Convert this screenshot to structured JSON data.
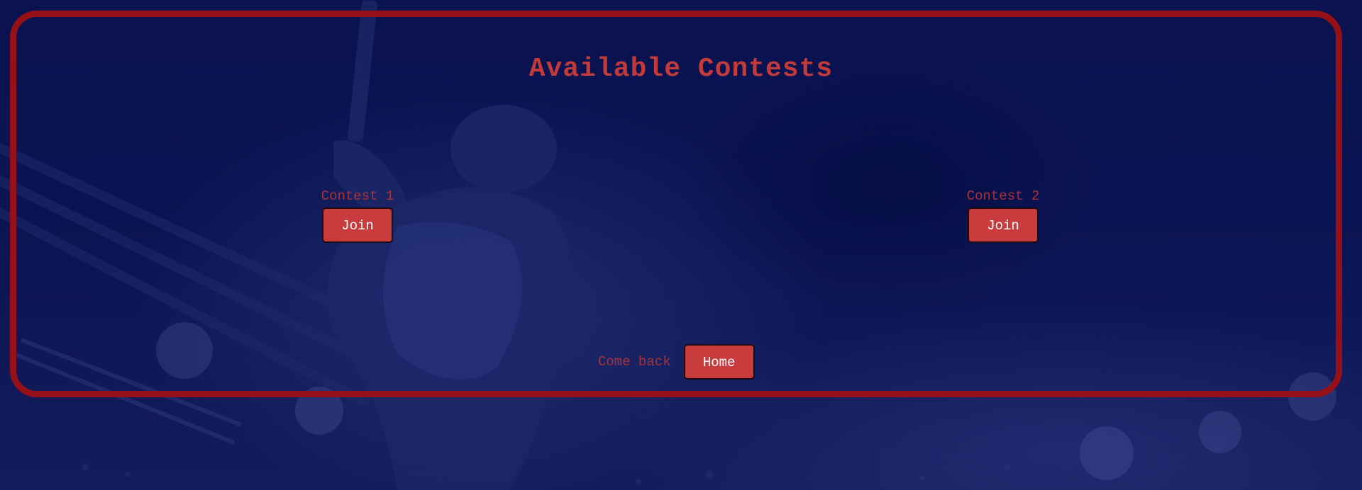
{
  "page": {
    "title": "Available Contests"
  },
  "contests": [
    {
      "label": "Contest 1",
      "button_label": "Join"
    },
    {
      "label": "Contest 2",
      "button_label": "Join"
    }
  ],
  "footer": {
    "text": "Come back",
    "home_label": "Home"
  },
  "colors": {
    "background": "#0c1550",
    "frame": "#951017",
    "title": "#c23a3a",
    "label": "#a9323a",
    "button": "#c83c3e",
    "button_text": "#ffffff"
  }
}
